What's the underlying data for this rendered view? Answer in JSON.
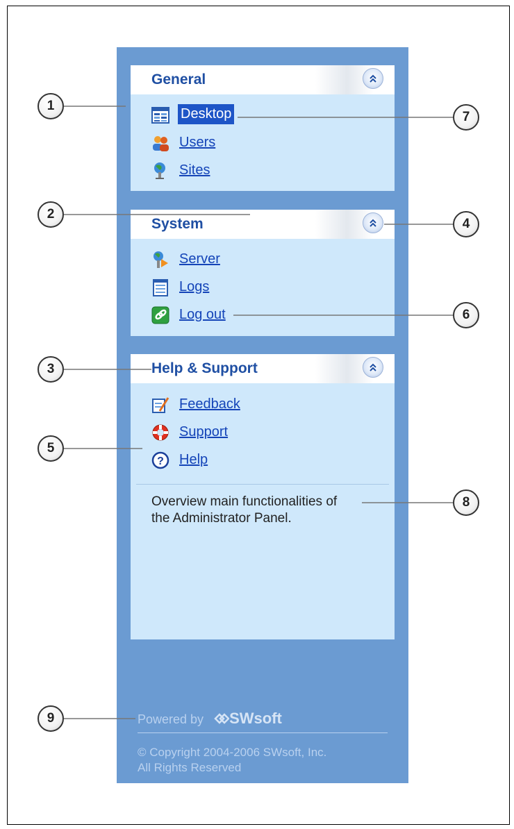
{
  "sections": {
    "general": {
      "title": "General",
      "items": [
        {
          "label": "Desktop",
          "icon": "desktop-icon",
          "selected": true
        },
        {
          "label": "Users",
          "icon": "users-icon"
        },
        {
          "label": "Sites",
          "icon": "sites-icon"
        }
      ]
    },
    "system": {
      "title": "System",
      "items": [
        {
          "label": "Server",
          "icon": "server-icon"
        },
        {
          "label": "Logs",
          "icon": "logs-icon"
        },
        {
          "label": "Log out",
          "icon": "logout-icon"
        }
      ]
    },
    "help": {
      "title": "Help & Support",
      "items": [
        {
          "label": "Feedback",
          "icon": "feedback-icon"
        },
        {
          "label": "Support",
          "icon": "support-icon"
        },
        {
          "label": "Help",
          "icon": "help-icon"
        }
      ],
      "description": [
        "Overview main functionalities of",
        "the Administrator Panel."
      ]
    }
  },
  "footer": {
    "powered_by": "Powered by",
    "logo_text": "SWsoft",
    "copyright": "© Copyright 2004-2006 SWsoft, Inc.",
    "rights": "All Rights Reserved"
  },
  "callouts": [
    "1",
    "2",
    "3",
    "4",
    "5",
    "6",
    "7",
    "8",
    "9"
  ],
  "colors": {
    "panel": "#6b9bd2",
    "box": "#cfe8fb",
    "title": "#1f4fa3",
    "link": "#1444b8",
    "selected": "#1e55c7"
  }
}
